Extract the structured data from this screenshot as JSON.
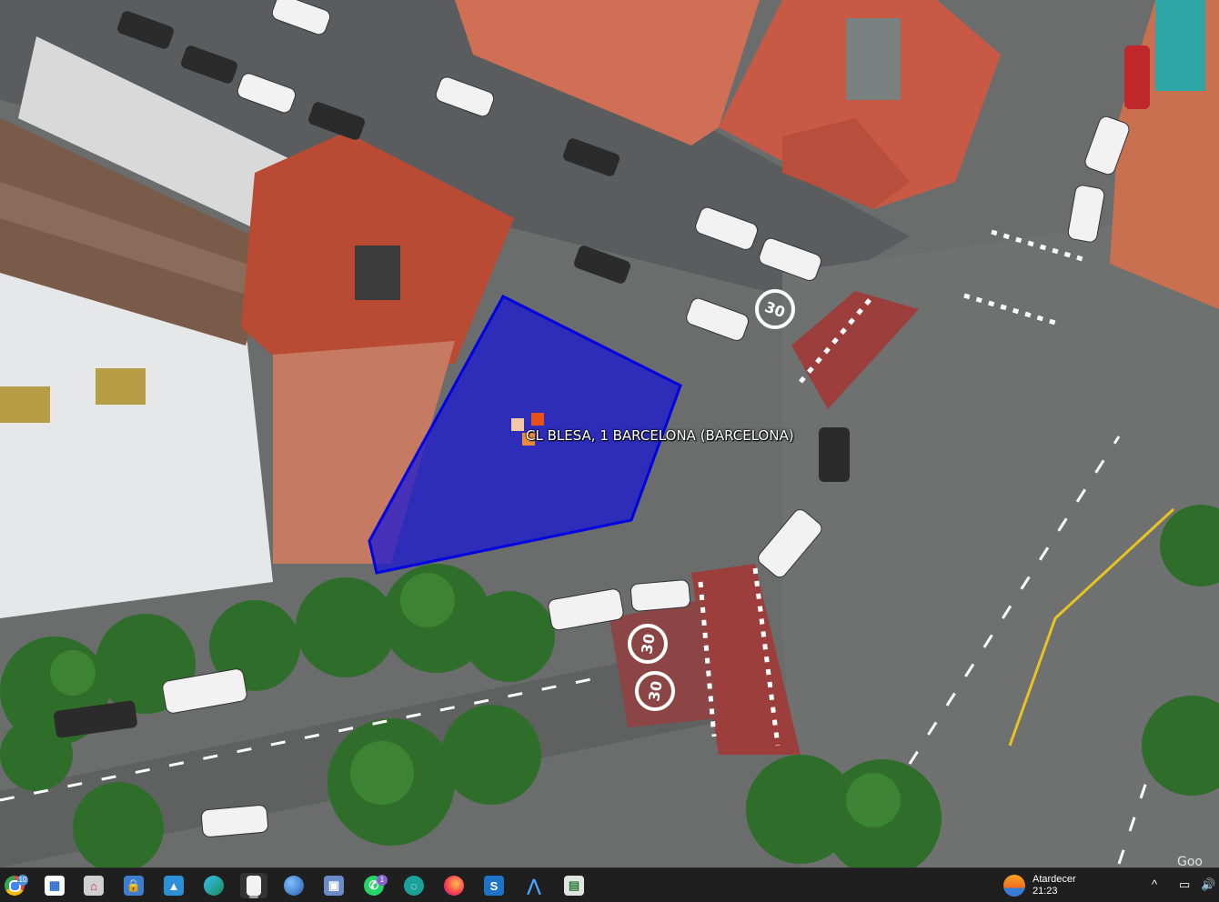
{
  "map": {
    "address_label": "CL BLESA, 1  BARCELONA (BARCELONA)",
    "road_markings": [
      "30",
      "30",
      "30"
    ],
    "watermark": "Goo",
    "polygon_color": "#1010d0"
  },
  "taskbar": {
    "apps": [
      {
        "name": "chrome-icon",
        "badge": "10"
      },
      {
        "name": "chart-app-icon"
      },
      {
        "name": "photo-viewer-icon"
      },
      {
        "name": "lock-app-icon"
      },
      {
        "name": "image-app-icon"
      },
      {
        "name": "edge-icon"
      },
      {
        "name": "notepad-icon"
      },
      {
        "name": "earth-icon"
      },
      {
        "name": "save-app-icon"
      },
      {
        "name": "whatsapp-icon",
        "badge": "1"
      },
      {
        "name": "swirl-app-icon"
      },
      {
        "name": "firefox-icon"
      },
      {
        "name": "s-app-icon"
      },
      {
        "name": "arrow-app-icon"
      },
      {
        "name": "window-app-icon"
      }
    ],
    "weather": {
      "label": "Atardecer",
      "time": "21:23"
    },
    "tray": {
      "chevron": "^",
      "network": "network-icon",
      "volume": "volume-icon"
    }
  }
}
